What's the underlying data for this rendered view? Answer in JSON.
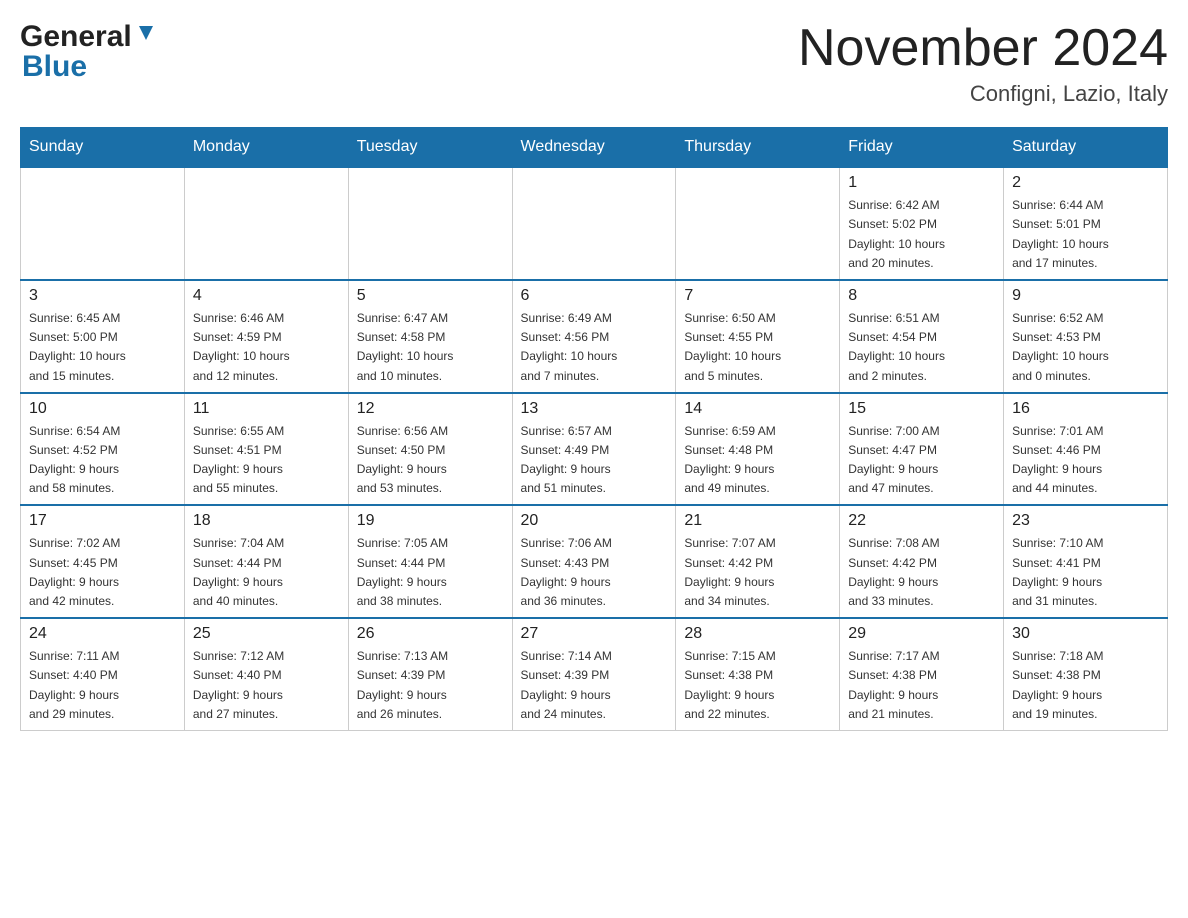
{
  "header": {
    "title": "November 2024",
    "subtitle": "Configni, Lazio, Italy",
    "logo_general": "General",
    "logo_blue": "Blue"
  },
  "weekdays": [
    "Sunday",
    "Monday",
    "Tuesday",
    "Wednesday",
    "Thursday",
    "Friday",
    "Saturday"
  ],
  "weeks": [
    {
      "days": [
        {
          "num": "",
          "info": "",
          "empty": true
        },
        {
          "num": "",
          "info": "",
          "empty": true
        },
        {
          "num": "",
          "info": "",
          "empty": true
        },
        {
          "num": "",
          "info": "",
          "empty": true
        },
        {
          "num": "",
          "info": "",
          "empty": true
        },
        {
          "num": "1",
          "info": "Sunrise: 6:42 AM\nSunset: 5:02 PM\nDaylight: 10 hours\nand 20 minutes.",
          "empty": false
        },
        {
          "num": "2",
          "info": "Sunrise: 6:44 AM\nSunset: 5:01 PM\nDaylight: 10 hours\nand 17 minutes.",
          "empty": false
        }
      ]
    },
    {
      "days": [
        {
          "num": "3",
          "info": "Sunrise: 6:45 AM\nSunset: 5:00 PM\nDaylight: 10 hours\nand 15 minutes.",
          "empty": false
        },
        {
          "num": "4",
          "info": "Sunrise: 6:46 AM\nSunset: 4:59 PM\nDaylight: 10 hours\nand 12 minutes.",
          "empty": false
        },
        {
          "num": "5",
          "info": "Sunrise: 6:47 AM\nSunset: 4:58 PM\nDaylight: 10 hours\nand 10 minutes.",
          "empty": false
        },
        {
          "num": "6",
          "info": "Sunrise: 6:49 AM\nSunset: 4:56 PM\nDaylight: 10 hours\nand 7 minutes.",
          "empty": false
        },
        {
          "num": "7",
          "info": "Sunrise: 6:50 AM\nSunset: 4:55 PM\nDaylight: 10 hours\nand 5 minutes.",
          "empty": false
        },
        {
          "num": "8",
          "info": "Sunrise: 6:51 AM\nSunset: 4:54 PM\nDaylight: 10 hours\nand 2 minutes.",
          "empty": false
        },
        {
          "num": "9",
          "info": "Sunrise: 6:52 AM\nSunset: 4:53 PM\nDaylight: 10 hours\nand 0 minutes.",
          "empty": false
        }
      ]
    },
    {
      "days": [
        {
          "num": "10",
          "info": "Sunrise: 6:54 AM\nSunset: 4:52 PM\nDaylight: 9 hours\nand 58 minutes.",
          "empty": false
        },
        {
          "num": "11",
          "info": "Sunrise: 6:55 AM\nSunset: 4:51 PM\nDaylight: 9 hours\nand 55 minutes.",
          "empty": false
        },
        {
          "num": "12",
          "info": "Sunrise: 6:56 AM\nSunset: 4:50 PM\nDaylight: 9 hours\nand 53 minutes.",
          "empty": false
        },
        {
          "num": "13",
          "info": "Sunrise: 6:57 AM\nSunset: 4:49 PM\nDaylight: 9 hours\nand 51 minutes.",
          "empty": false
        },
        {
          "num": "14",
          "info": "Sunrise: 6:59 AM\nSunset: 4:48 PM\nDaylight: 9 hours\nand 49 minutes.",
          "empty": false
        },
        {
          "num": "15",
          "info": "Sunrise: 7:00 AM\nSunset: 4:47 PM\nDaylight: 9 hours\nand 47 minutes.",
          "empty": false
        },
        {
          "num": "16",
          "info": "Sunrise: 7:01 AM\nSunset: 4:46 PM\nDaylight: 9 hours\nand 44 minutes.",
          "empty": false
        }
      ]
    },
    {
      "days": [
        {
          "num": "17",
          "info": "Sunrise: 7:02 AM\nSunset: 4:45 PM\nDaylight: 9 hours\nand 42 minutes.",
          "empty": false
        },
        {
          "num": "18",
          "info": "Sunrise: 7:04 AM\nSunset: 4:44 PM\nDaylight: 9 hours\nand 40 minutes.",
          "empty": false
        },
        {
          "num": "19",
          "info": "Sunrise: 7:05 AM\nSunset: 4:44 PM\nDaylight: 9 hours\nand 38 minutes.",
          "empty": false
        },
        {
          "num": "20",
          "info": "Sunrise: 7:06 AM\nSunset: 4:43 PM\nDaylight: 9 hours\nand 36 minutes.",
          "empty": false
        },
        {
          "num": "21",
          "info": "Sunrise: 7:07 AM\nSunset: 4:42 PM\nDaylight: 9 hours\nand 34 minutes.",
          "empty": false
        },
        {
          "num": "22",
          "info": "Sunrise: 7:08 AM\nSunset: 4:42 PM\nDaylight: 9 hours\nand 33 minutes.",
          "empty": false
        },
        {
          "num": "23",
          "info": "Sunrise: 7:10 AM\nSunset: 4:41 PM\nDaylight: 9 hours\nand 31 minutes.",
          "empty": false
        }
      ]
    },
    {
      "days": [
        {
          "num": "24",
          "info": "Sunrise: 7:11 AM\nSunset: 4:40 PM\nDaylight: 9 hours\nand 29 minutes.",
          "empty": false
        },
        {
          "num": "25",
          "info": "Sunrise: 7:12 AM\nSunset: 4:40 PM\nDaylight: 9 hours\nand 27 minutes.",
          "empty": false
        },
        {
          "num": "26",
          "info": "Sunrise: 7:13 AM\nSunset: 4:39 PM\nDaylight: 9 hours\nand 26 minutes.",
          "empty": false
        },
        {
          "num": "27",
          "info": "Sunrise: 7:14 AM\nSunset: 4:39 PM\nDaylight: 9 hours\nand 24 minutes.",
          "empty": false
        },
        {
          "num": "28",
          "info": "Sunrise: 7:15 AM\nSunset: 4:38 PM\nDaylight: 9 hours\nand 22 minutes.",
          "empty": false
        },
        {
          "num": "29",
          "info": "Sunrise: 7:17 AM\nSunset: 4:38 PM\nDaylight: 9 hours\nand 21 minutes.",
          "empty": false
        },
        {
          "num": "30",
          "info": "Sunrise: 7:18 AM\nSunset: 4:38 PM\nDaylight: 9 hours\nand 19 minutes.",
          "empty": false
        }
      ]
    }
  ]
}
